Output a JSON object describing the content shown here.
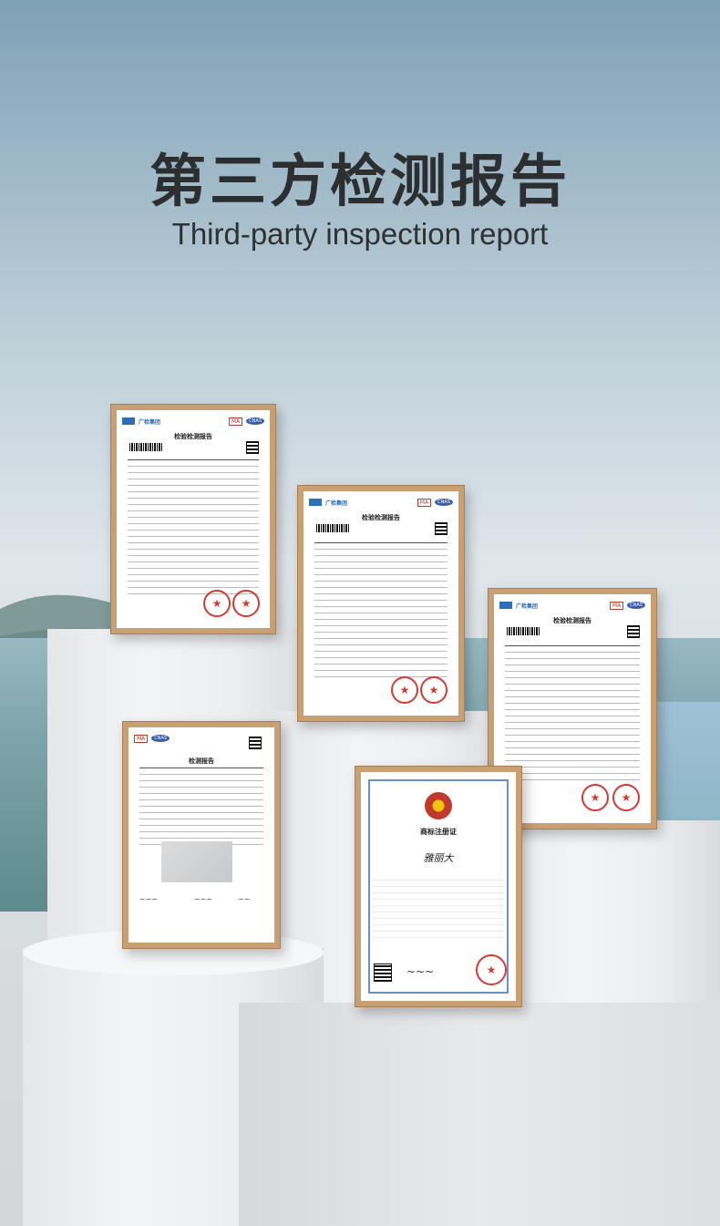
{
  "header": {
    "title": "第三方检测报告",
    "subtitle": "Third-party inspection report"
  },
  "certificates": {
    "report1": {
      "title": "检验检测报告",
      "org": "广检集团"
    },
    "report2": {
      "title": "检验检测报告",
      "org": "广检集团"
    },
    "report3": {
      "title": "检验检测报告",
      "org": "广检集团"
    },
    "report4": {
      "title": "检测报告"
    },
    "trademark": {
      "title": "商标注册证",
      "mark": "雅丽大"
    }
  },
  "colors": {
    "frame": "#c9a074",
    "seal": "#d63a2f",
    "title": "#2c2e30"
  }
}
